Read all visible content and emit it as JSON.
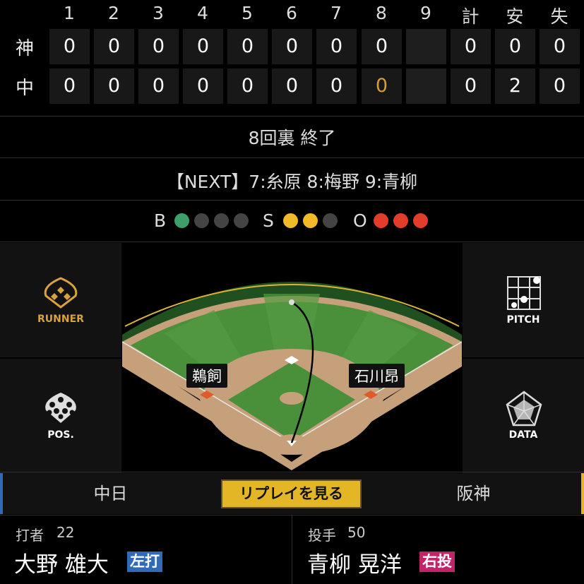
{
  "scoreboard": {
    "innings": [
      "1",
      "2",
      "3",
      "4",
      "5",
      "6",
      "7",
      "8",
      "9"
    ],
    "totals_headers": [
      "計",
      "安",
      "失"
    ],
    "teams": [
      {
        "name": "神",
        "innings": [
          "0",
          "0",
          "0",
          "0",
          "0",
          "0",
          "0",
          "0",
          ""
        ],
        "totals": [
          "0",
          "0",
          "0"
        ]
      },
      {
        "name": "中",
        "innings": [
          "0",
          "0",
          "0",
          "0",
          "0",
          "0",
          "0",
          "0",
          ""
        ],
        "totals": [
          "0",
          "2",
          "0"
        ]
      }
    ],
    "current_inning_color": "#d79c3a"
  },
  "status": "8回裏 終了",
  "next_batters": "【NEXT】7:糸原 8:梅野 9:青柳",
  "count": {
    "ball_label": "B",
    "strike_label": "S",
    "out_label": "O",
    "balls": 1,
    "strikes": 2,
    "outs": 3,
    "ball_color": "#3da06a",
    "strike_color": "#f2b928",
    "out_color": "#e23d2a"
  },
  "side_buttons": {
    "runner": "RUNNER",
    "pitch": "PITCH",
    "pos": "POS.",
    "data": "DATA"
  },
  "field": {
    "left_runner_label": "鵜飼",
    "right_runner_label": "石川昂"
  },
  "tabs": {
    "home": "中日",
    "away": "阪神",
    "replay": "リプレイを見る"
  },
  "batter": {
    "role": "打者",
    "number": "22",
    "name": "大野 雄大",
    "hand": "左打",
    "hand_color": "#2f6bb8"
  },
  "pitcher": {
    "role": "投手",
    "number": "50",
    "name": "青柳 晃洋",
    "hand": "右投",
    "hand_color": "#c2246a"
  }
}
